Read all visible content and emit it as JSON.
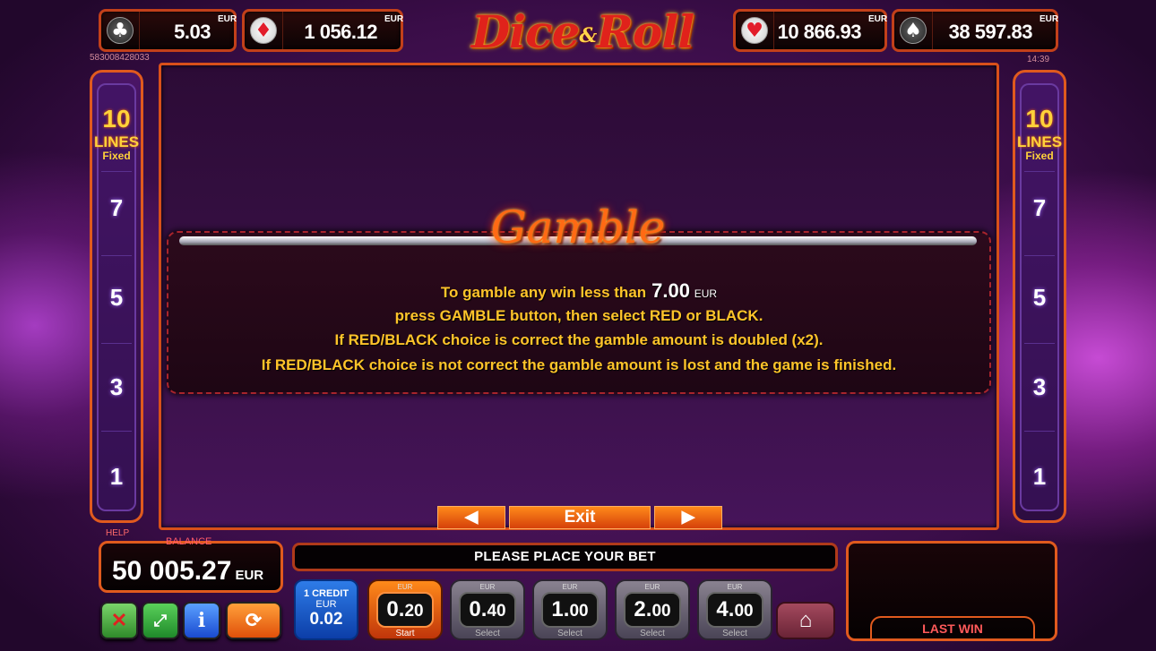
{
  "jackpots": [
    {
      "suit": "♣",
      "value": "5.03",
      "currency": "EUR"
    },
    {
      "suit": "♦",
      "value": "1 056.12",
      "currency": "EUR"
    },
    {
      "suit": "♥",
      "value": "10 866.93",
      "currency": "EUR"
    },
    {
      "suit": "♠",
      "value": "38 597.83",
      "currency": "EUR"
    }
  ],
  "logo": {
    "part1": "Dice",
    "amp": "&",
    "part2": "Roll"
  },
  "session_id": "583008428033",
  "clock": "14:39",
  "lines_panel": {
    "count": "10",
    "label": "LINES",
    "mode": "Fixed",
    "numbers": [
      "7",
      "5",
      "3",
      "1"
    ]
  },
  "gamble": {
    "title": "Gamble",
    "line1_prefix": "To gamble any win less than",
    "limit": "7.00",
    "limit_currency": "EUR",
    "line2": "press GAMBLE button, then select RED or BLACK.",
    "line3": "If RED/BLACK choice is correct the gamble amount is doubled (x2).",
    "line4": "If RED/BLACK choice is not correct the gamble amount is lost and the game is finished."
  },
  "nav": {
    "prev": "◀",
    "exit": "Exit",
    "next": "▶"
  },
  "help_label": "HELP",
  "balance": {
    "label": "BALANCE",
    "value": "50 005.27",
    "currency": "EUR"
  },
  "message": "PLEASE PLACE YOUR BET",
  "last_win": {
    "label": "LAST WIN"
  },
  "credit": {
    "label": "1 CREDIT",
    "currency": "EUR",
    "value": "0.02"
  },
  "bets": [
    {
      "currency": "EUR",
      "int": "0.",
      "dec": "20",
      "sub": "Start",
      "selected": true
    },
    {
      "currency": "EUR",
      "int": "0.",
      "dec": "40",
      "sub": "Select",
      "selected": false
    },
    {
      "currency": "EUR",
      "int": "1.",
      "dec": "00",
      "sub": "Select",
      "selected": false
    },
    {
      "currency": "EUR",
      "int": "2.",
      "dec": "00",
      "sub": "Select",
      "selected": false
    },
    {
      "currency": "EUR",
      "int": "4.",
      "dec": "00",
      "sub": "Select",
      "selected": false
    }
  ],
  "icons": {
    "sound": "sound-muted-icon",
    "fullscreen": "fullscreen-icon",
    "info": "info-icon",
    "autoplay": "autoplay-icon",
    "home": "home-icon"
  },
  "colors": {
    "accent": "#e05a1e",
    "text_gold": "#ffc42a",
    "selected_bet": "#ff8a1a",
    "credit_blue": "#2e7ce8"
  }
}
